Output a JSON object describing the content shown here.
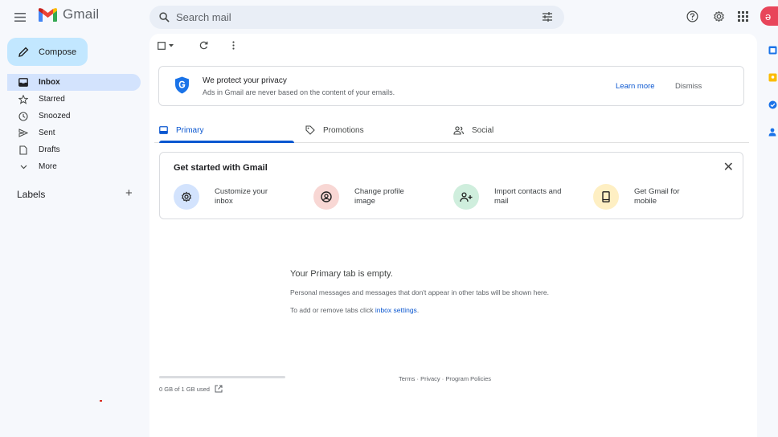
{
  "app": {
    "name": "Gmail"
  },
  "search": {
    "placeholder": "Search mail"
  },
  "sidebar": {
    "compose_label": "Compose",
    "items": [
      {
        "label": "Inbox",
        "icon": "inbox-icon",
        "active": true
      },
      {
        "label": "Starred",
        "icon": "star-icon"
      },
      {
        "label": "Snoozed",
        "icon": "clock-icon"
      },
      {
        "label": "Sent",
        "icon": "send-icon"
      },
      {
        "label": "Drafts",
        "icon": "draft-icon"
      },
      {
        "label": "More",
        "icon": "chevron-down-icon"
      }
    ],
    "labels_title": "Labels",
    "labels_add": "+"
  },
  "avatar": {
    "initial": "ə"
  },
  "privacy": {
    "title": "We protect your privacy",
    "subtitle": "Ads in Gmail are never based on the content of your emails.",
    "learn_more": "Learn more",
    "dismiss": "Dismiss"
  },
  "tabs": [
    {
      "label": "Primary",
      "icon": "inbox-icon",
      "active": true
    },
    {
      "label": "Promotions",
      "icon": "tag-icon"
    },
    {
      "label": "Social",
      "icon": "people-icon"
    }
  ],
  "get_started": {
    "title": "Get started with Gmail",
    "close": "✕",
    "items": [
      {
        "label": "Customize your inbox",
        "icon": "settings-icon",
        "color": "#d3e3fd"
      },
      {
        "label": "Change profile image",
        "icon": "profile-icon",
        "color": "#f8d7d4"
      },
      {
        "label": "Import contacts and mail",
        "icon": "add-contact-icon",
        "color": "#cfeedd"
      },
      {
        "label": "Get Gmail for mobile",
        "icon": "phone-icon",
        "color": "#feefc3"
      }
    ]
  },
  "empty": {
    "title": "Your Primary tab is empty.",
    "line1": "Personal messages and messages that don't appear in other tabs will be shown here.",
    "line2_prefix": "To add or remove tabs click ",
    "line2_link": "inbox settings",
    "line2_suffix": "."
  },
  "storage": {
    "text": "0 GB of 1 GB used",
    "used_fraction": 0
  },
  "footer": {
    "links": "Terms · Privacy · Program Policies"
  },
  "colors": {
    "accent": "#0b57d0",
    "compose_bg": "#c2e7ff",
    "active_nav": "#d3e3fd",
    "avatar": "#e8455a"
  }
}
